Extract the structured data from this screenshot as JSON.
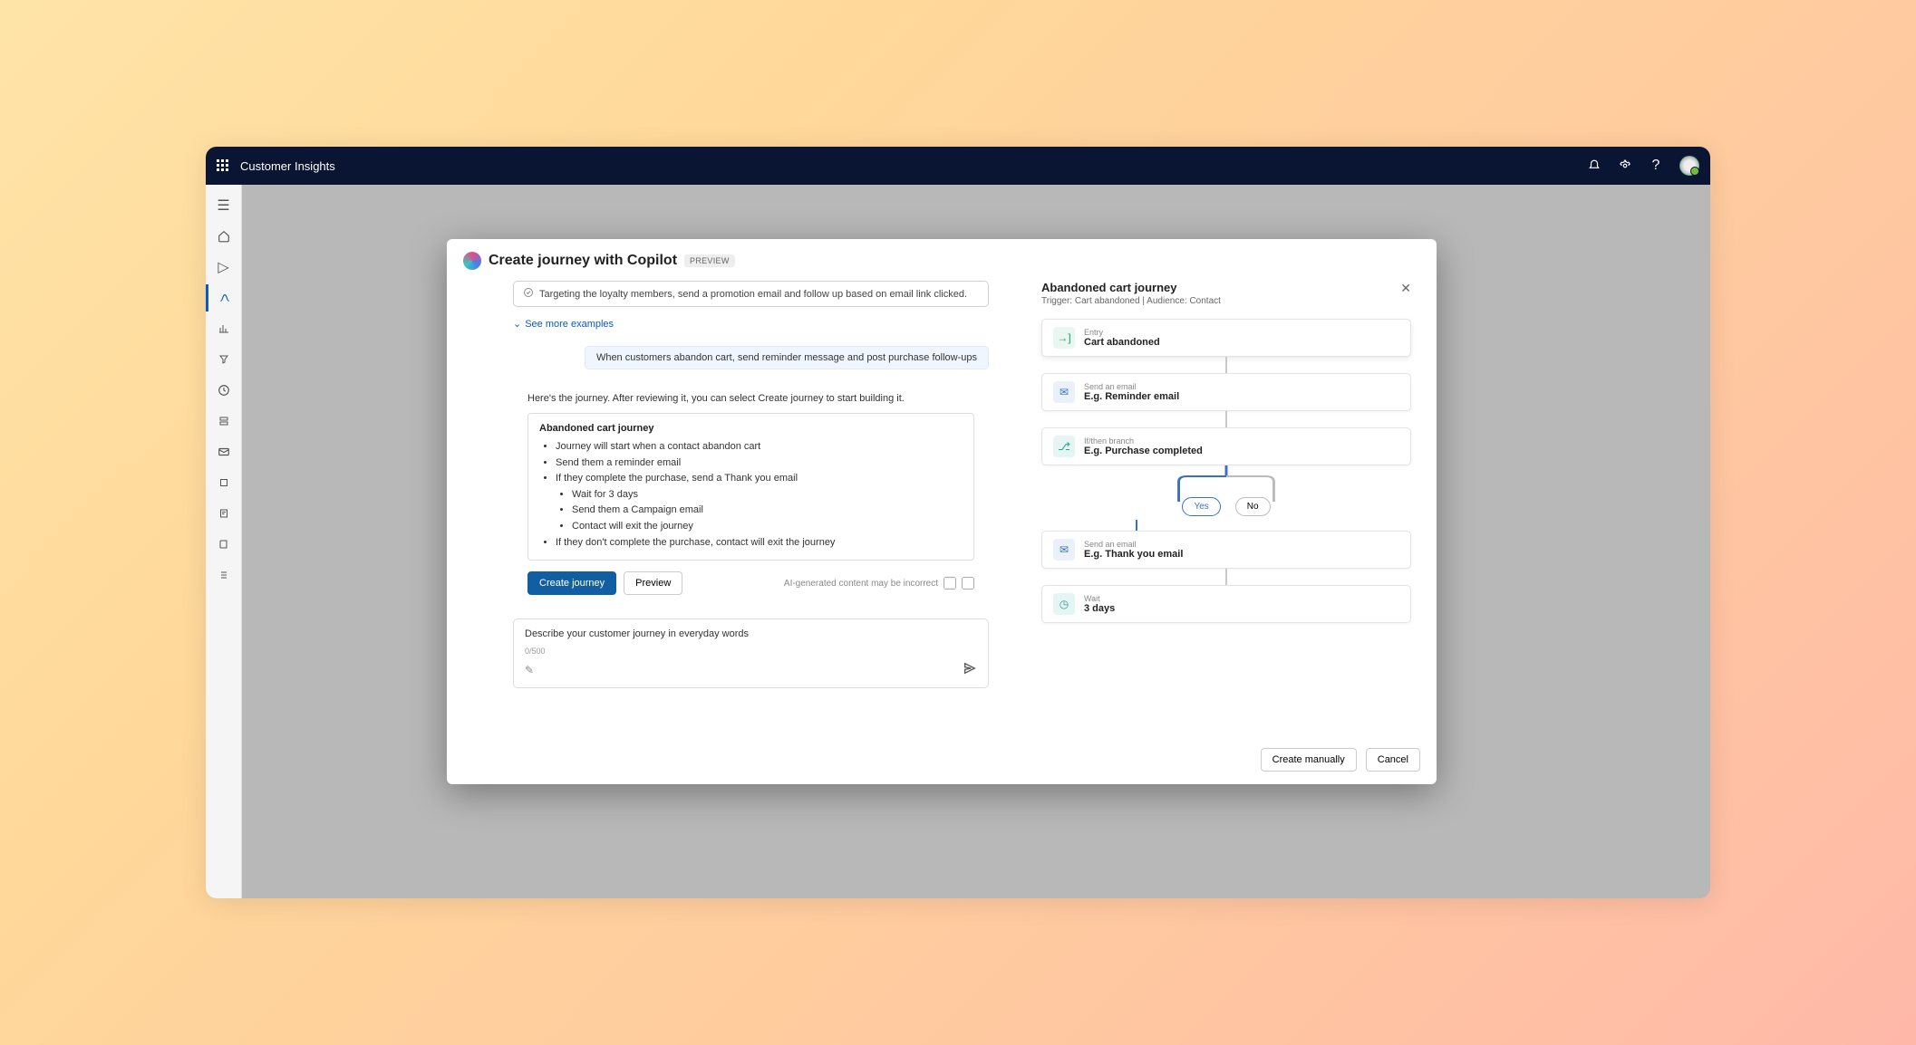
{
  "app": {
    "title": "Customer Insights"
  },
  "modal": {
    "title": "Create journey with Copilot",
    "badge": "PREVIEW",
    "suggestion": "Targeting the loyalty members, send a promotion email and follow up based on email link clicked.",
    "see_more": "See more examples",
    "user_prompt": "When customers abandon cart, send reminder message and post purchase follow-ups",
    "ai_intro": "Here's the journey. After reviewing it, you can select Create journey to start building it.",
    "journey_title": "Abandoned cart journey",
    "bullets": {
      "b1": "Journey will start when a contact abandon cart",
      "b2": "Send them a reminder email",
      "b3": "If they complete the purchase, send a Thank you email",
      "b3a": "Wait for 3 days",
      "b3b": "Send them a Campaign email",
      "b3c": "Contact will exit the journey",
      "b4": "If they don't complete the purchase, contact will exit the journey"
    },
    "create_journey": "Create journey",
    "preview": "Preview",
    "disclaimer": "AI-generated content may be incorrect",
    "prompt_label": "Describe your customer journey in everyday words",
    "prompt_counter": "0/500"
  },
  "preview_panel": {
    "title": "Abandoned cart journey",
    "subtitle": "Trigger: Cart abandoned  |  Audience: Contact",
    "n1_small": "Entry",
    "n1_line": "Cart abandoned",
    "n2_small": "Send an email",
    "n2_line": "E.g. Reminder email",
    "n3_small": "If/then branch",
    "n3_line": "E.g. Purchase completed",
    "yes": "Yes",
    "no": "No",
    "n4_small": "Send an email",
    "n4_line": "E.g. Thank you email",
    "n5_small": "Wait",
    "n5_line": "3 days"
  },
  "footer": {
    "create_manually": "Create manually",
    "cancel": "Cancel"
  }
}
